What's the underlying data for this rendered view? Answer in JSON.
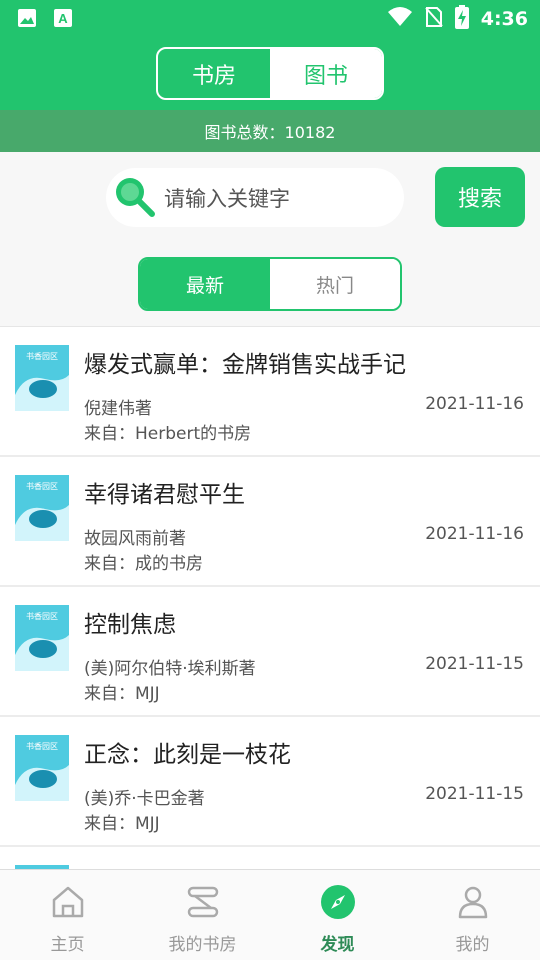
{
  "status_bar": {
    "time": "4:36"
  },
  "top_tabs": [
    {
      "label": "书房",
      "active": false
    },
    {
      "label": "图书",
      "active": true
    }
  ],
  "total_label": "图书总数：10182",
  "search": {
    "placeholder": "请输入关键字",
    "button_label": "搜索"
  },
  "filter_tabs": [
    {
      "label": "最新",
      "active": true
    },
    {
      "label": "热门",
      "active": false
    }
  ],
  "cover_text": "书香园区",
  "books": [
    {
      "title": "爆发式赢单：金牌销售实战手记",
      "author": "倪建伟著",
      "source": "来自：Herbert的书房",
      "date": "2021-11-16"
    },
    {
      "title": "幸得诸君慰平生",
      "author": "故园风雨前著",
      "source": "来自：成的书房",
      "date": "2021-11-16"
    },
    {
      "title": "控制焦虑",
      "author": "(美)阿尔伯特·埃利斯著",
      "source": "来自：MJJ",
      "date": "2021-11-15"
    },
    {
      "title": "正念：此刻是一枝花",
      "author": "(美)乔·卡巴金著",
      "source": "来自：MJJ",
      "date": "2021-11-15"
    }
  ],
  "bottom_nav": [
    {
      "label": "主页",
      "icon": "home-icon",
      "active": false
    },
    {
      "label": "我的书房",
      "icon": "bookshelf-icon",
      "active": false
    },
    {
      "label": "发现",
      "icon": "compass-icon",
      "active": true
    },
    {
      "label": "我的",
      "icon": "person-icon",
      "active": false
    }
  ],
  "colors": {
    "primary": "#22c46e",
    "header_bar": "#48a96b",
    "nav_active": "#2e8b57"
  }
}
